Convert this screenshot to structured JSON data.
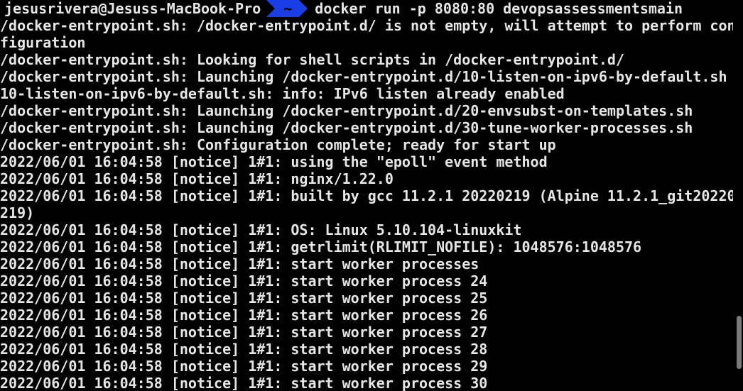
{
  "prompt": {
    "user_host": "jesusrivera@Jesuss-MacBook-Pro",
    "path": "~",
    "command": "docker run -p 8080:80 devopsassessmentsmain"
  },
  "output": [
    "/docker-entrypoint.sh: /docker-entrypoint.d/ is not empty, will attempt to perform con",
    "figuration",
    "/docker-entrypoint.sh: Looking for shell scripts in /docker-entrypoint.d/",
    "/docker-entrypoint.sh: Launching /docker-entrypoint.d/10-listen-on-ipv6-by-default.sh",
    "10-listen-on-ipv6-by-default.sh: info: IPv6 listen already enabled",
    "/docker-entrypoint.sh: Launching /docker-entrypoint.d/20-envsubst-on-templates.sh",
    "/docker-entrypoint.sh: Launching /docker-entrypoint.d/30-tune-worker-processes.sh",
    "/docker-entrypoint.sh: Configuration complete; ready for start up",
    "2022/06/01 16:04:58 [notice] 1#1: using the \"epoll\" event method",
    "2022/06/01 16:04:58 [notice] 1#1: nginx/1.22.0",
    "2022/06/01 16:04:58 [notice] 1#1: built by gcc 11.2.1 20220219 (Alpine 11.2.1_git20220",
    "219)",
    "2022/06/01 16:04:58 [notice] 1#1: OS: Linux 5.10.104-linuxkit",
    "2022/06/01 16:04:58 [notice] 1#1: getrlimit(RLIMIT_NOFILE): 1048576:1048576",
    "2022/06/01 16:04:58 [notice] 1#1: start worker processes",
    "2022/06/01 16:04:58 [notice] 1#1: start worker process 24",
    "2022/06/01 16:04:58 [notice] 1#1: start worker process 25",
    "2022/06/01 16:04:58 [notice] 1#1: start worker process 26",
    "2022/06/01 16:04:58 [notice] 1#1: start worker process 27",
    "2022/06/01 16:04:58 [notice] 1#1: start worker process 28",
    "2022/06/01 16:04:58 [notice] 1#1: start worker process 29",
    "2022/06/01 16:04:58 [notice] 1#1: start worker process 30"
  ],
  "colors": {
    "background": "#000000",
    "text": "#e6e6e6",
    "prompt_path_bg": "#1a3ee6"
  }
}
